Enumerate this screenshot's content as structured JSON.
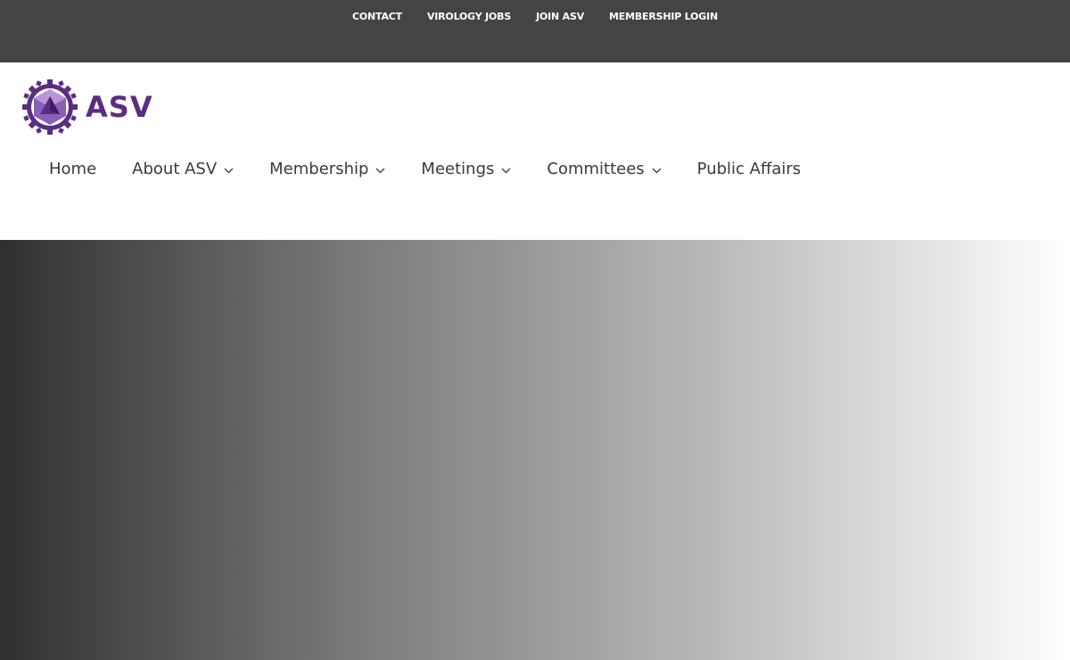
{
  "topbar": {
    "links": [
      {
        "label": "CONTACT"
      },
      {
        "label": "VIROLOGY JOBS"
      },
      {
        "label": "JOIN ASV"
      },
      {
        "label": "MEMBERSHIP LOGIN"
      }
    ]
  },
  "header": {
    "logo": {
      "text": "ASV",
      "icon": "virus-capsid-icon"
    },
    "nav": [
      {
        "label": "Home",
        "has_dropdown": false
      },
      {
        "label": "About ASV",
        "has_dropdown": true
      },
      {
        "label": "Membership",
        "has_dropdown": true
      },
      {
        "label": "Meetings",
        "has_dropdown": true
      },
      {
        "label": "Committees",
        "has_dropdown": true
      },
      {
        "label": "Public Affairs",
        "has_dropdown": false
      }
    ]
  },
  "colors": {
    "topbar_bg": "#444444",
    "brand_purple": "#5a2d82",
    "nav_text": "#3a3a3a",
    "hero_gradient_start": "#303030",
    "hero_gradient_end": "#ffffff"
  }
}
